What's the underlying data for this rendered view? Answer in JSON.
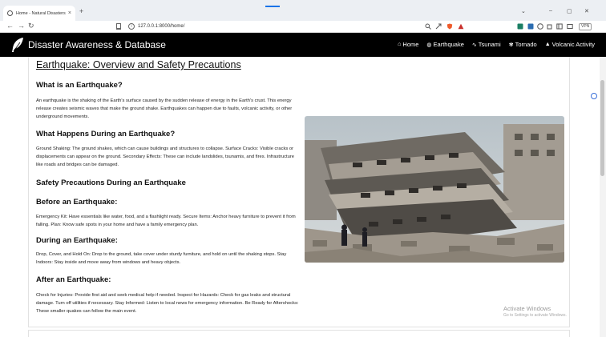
{
  "browser": {
    "tab_title": "Home - Natural Disasters Datab",
    "tab_close": "×",
    "new_tab": "+",
    "url": "127.0.0.1:8000/home/",
    "vpn": "VPN",
    "back": "←",
    "forward": "→",
    "reload": "↻",
    "minimize": "–",
    "maximize": "▢",
    "close": "✕",
    "chevron": "⌄"
  },
  "site": {
    "brand": "Disaster Awareness & Database",
    "nav": [
      {
        "icon": "⌂",
        "label": "Home"
      },
      {
        "icon": "◍",
        "label": "Earthquake"
      },
      {
        "icon": "∿",
        "label": "Tsunami"
      },
      {
        "icon": "✾",
        "label": "Tornado"
      },
      {
        "icon": "▲",
        "label": "Volcanic Activity"
      }
    ]
  },
  "article": {
    "title": "Earthquake: Overview and Safety Precautions",
    "what_heading": "What is an Earthquake?",
    "what_text": "An earthquake is the shaking of the Earth's surface caused by the sudden release of energy in the Earth's crust. This energy release creates seismic waves that make the ground shake. Earthquakes can happen due to faults, volcanic activity, or other underground movements.",
    "during_heading": "What Happens During an Earthquake?",
    "during_text": "Ground Shaking: The ground shakes, which can cause buildings and structures to collapse. Surface Cracks: Visible cracks or displacements can appear on the ground. Secondary Effects: These can include landslides, tsunamis, and fires. Infrastructure like roads and bridges can be damaged.",
    "safety_heading": "Safety Precautions During an Earthquake",
    "before_heading": "Before an Earthquake:",
    "before_text": "Emergency Kit: Have essentials like water, food, and a flashlight ready. Secure Items: Anchor heavy furniture to prevent it from falling. Plan: Know safe spots in your home and have a family emergency plan.",
    "during2_heading": "During an Earthquake:",
    "during2_text": "Drop, Cover, and Hold On: Drop to the ground, take cover under sturdy furniture, and hold on until the shaking stops. Stay Indoors: Stay inside and move away from windows and heavy objects.",
    "after_heading": "After an Earthquake:",
    "after_text": "Check for Injuries: Provide first aid and seek medical help if needed. Inspect for Hazards: Check for gas leaks and structural damage. Turn off utilities if necessary. Stay Informed: Listen to local news for emergency information. Be Ready for Aftershocks: These smaller quakes can follow the main event."
  },
  "os": {
    "activate_title": "Activate Windows",
    "activate_sub": "Go to Settings to activate Windows."
  }
}
